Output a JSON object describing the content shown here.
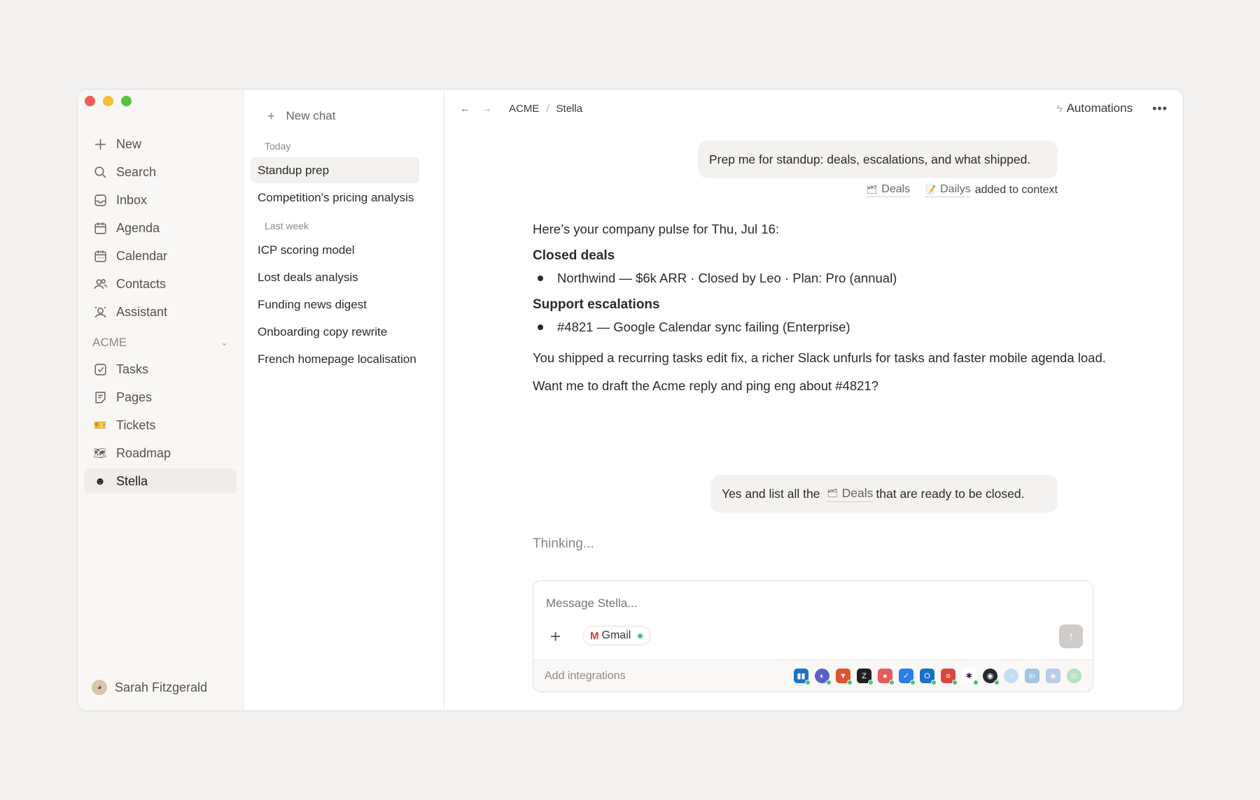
{
  "sidebar": {
    "nav": [
      {
        "label": "New",
        "icon": "plus-icon"
      },
      {
        "label": "Search",
        "icon": "search-icon"
      },
      {
        "label": "Inbox",
        "icon": "inbox-icon"
      },
      {
        "label": "Agenda",
        "icon": "agenda-icon"
      },
      {
        "label": "Calendar",
        "icon": "calendar-icon"
      },
      {
        "label": "Contacts",
        "icon": "contacts-icon"
      },
      {
        "label": "Assistant",
        "icon": "assistant-icon"
      }
    ],
    "workspace": "ACME",
    "workspace_items": [
      {
        "label": "Tasks",
        "icon": "tasks-icon"
      },
      {
        "label": "Pages",
        "icon": "pages-icon"
      },
      {
        "label": "Tickets",
        "icon": "tickets-icon"
      },
      {
        "label": "Roadmap",
        "icon": "roadmap-icon"
      },
      {
        "label": "Stella",
        "icon": "stella-avatar-icon"
      }
    ],
    "user": "Sarah Fitzgerald"
  },
  "chatlist": {
    "new_chat": "New chat",
    "today_label": "Today",
    "today": [
      "Standup prep",
      "Competition's pricing analysis"
    ],
    "last_week_label": "Last week",
    "last_week": [
      "ICP scoring model",
      "Lost deals analysis",
      "Funding news digest",
      "Onboarding copy rewrite",
      "French homepage localisation"
    ]
  },
  "header": {
    "crumb_1": "ACME",
    "crumb_sep": "/",
    "crumb_2": "Stella",
    "automations": "Automations"
  },
  "conversation": {
    "user_msg_1": "Prep me for standup: deals, escalations, and what shipped.",
    "context_tag_1": "Deals",
    "context_tag_2": "Dailys",
    "context_suffix": "added to context",
    "answer_intro": "Here’s your company pulse for Thu, Jul 16:",
    "closed_deals_title": "Closed deals",
    "closed_deals_item": "Northwind — $6k ARR · Closed by Leo · Plan: Pro (annual)",
    "escalations_title": "Support escalations",
    "escalations_item": "#4821 — Google Calendar sync failing (Enterprise)",
    "shipped_text": "You shipped a recurring tasks edit fix, a richer Slack unfurls for tasks and faster mobile agenda load.",
    "question_text": "Want me to draft the Acme reply and ping eng about #4821?",
    "user_msg_2_pre": "Yes and list all the",
    "user_msg_2_tag": "Deals",
    "user_msg_2_post": "that are ready to be closed.",
    "thinking": "Thinking..."
  },
  "composer": {
    "placeholder": "Message Stella...",
    "chip": "Gmail",
    "add_integrations": "Add integrations",
    "integration_icons": [
      "trello-icon",
      "linear-icon",
      "gitlab-icon",
      "zendesk-icon",
      "asana-icon",
      "check-icon",
      "outlook-icon",
      "todoist-icon",
      "slack-icon",
      "github-icon",
      "app-icon",
      "linkedin-icon",
      "app-icon",
      "whatsapp-icon"
    ]
  },
  "colors": {
    "accent_green": "#49c27a",
    "traffic_red": "#ee5e55",
    "traffic_yellow": "#f4bd34",
    "traffic_green": "#55c33e"
  }
}
